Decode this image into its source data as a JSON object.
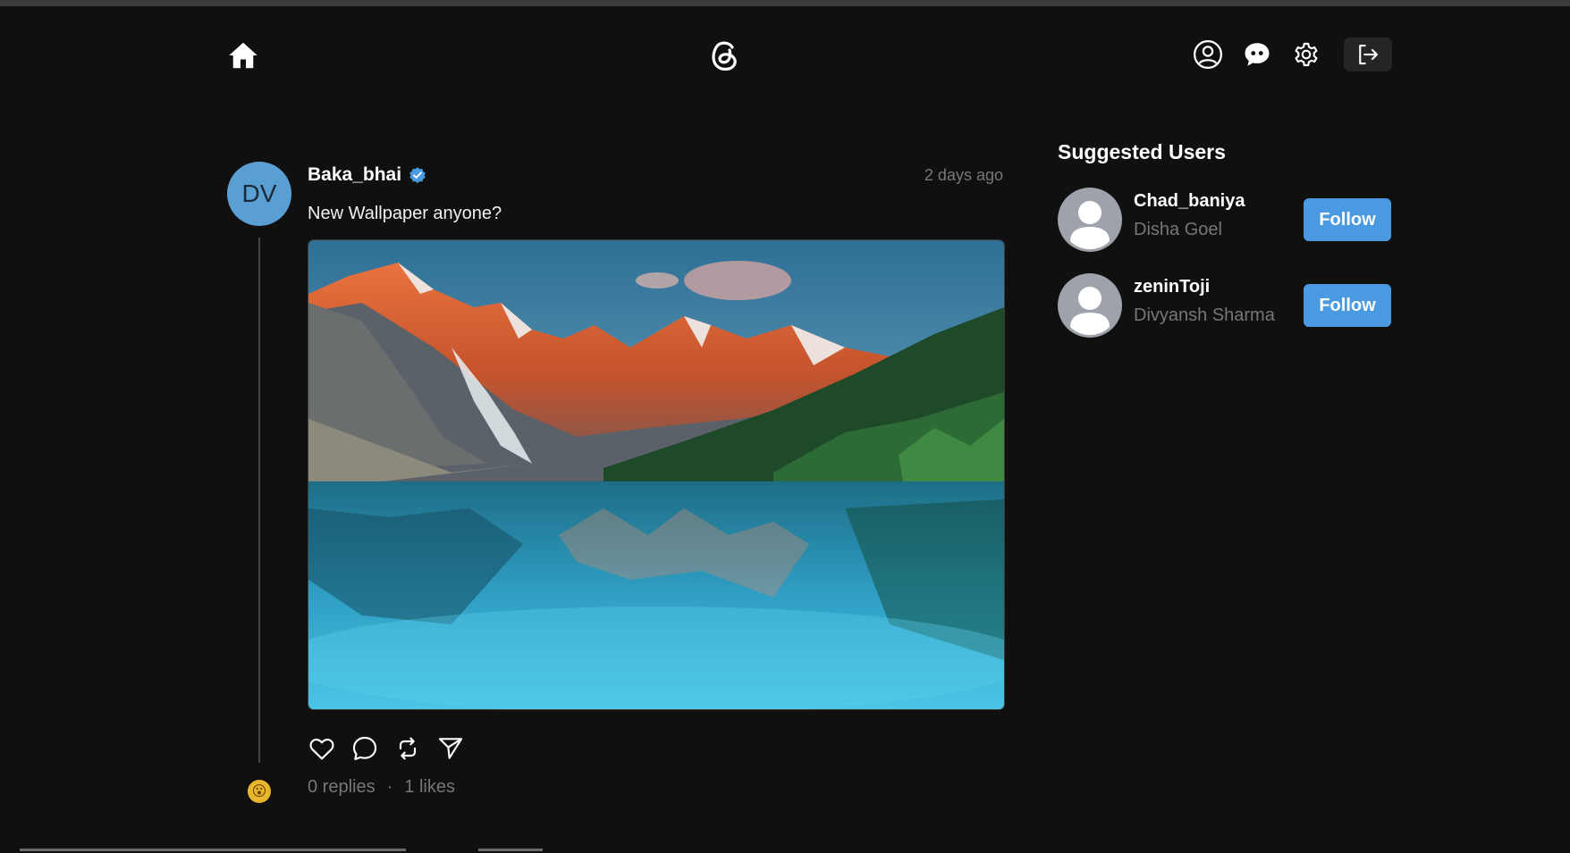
{
  "nav": {
    "home_icon": "home-icon",
    "logo_icon": "threads-logo-icon",
    "profile_icon": "user-circle-icon",
    "chat_icon": "chat-bubble-icon",
    "settings_icon": "gear-icon",
    "logout_icon": "logout-icon"
  },
  "post": {
    "avatar_initials": "DV",
    "username": "Baka_bhai",
    "verified": true,
    "timestamp": "2 days ago",
    "text": "New Wallpaper anyone?",
    "image_alt": "Mountain lake wallpaper",
    "replies": "0 replies",
    "separator": "·",
    "likes": "1 likes",
    "reply_emoji": "😮"
  },
  "suggested": {
    "title": "Suggested Users",
    "users": [
      {
        "username": "Chad_baniya",
        "name": "Disha Goel",
        "button": "Follow"
      },
      {
        "username": "zeninToji",
        "name": "Divyansh Sharma",
        "button": "Follow"
      }
    ]
  },
  "colors": {
    "background": "#101010",
    "accent": "#4a9ae1",
    "avatar_bg": "#5a9fd4",
    "muted_text": "#777777"
  }
}
